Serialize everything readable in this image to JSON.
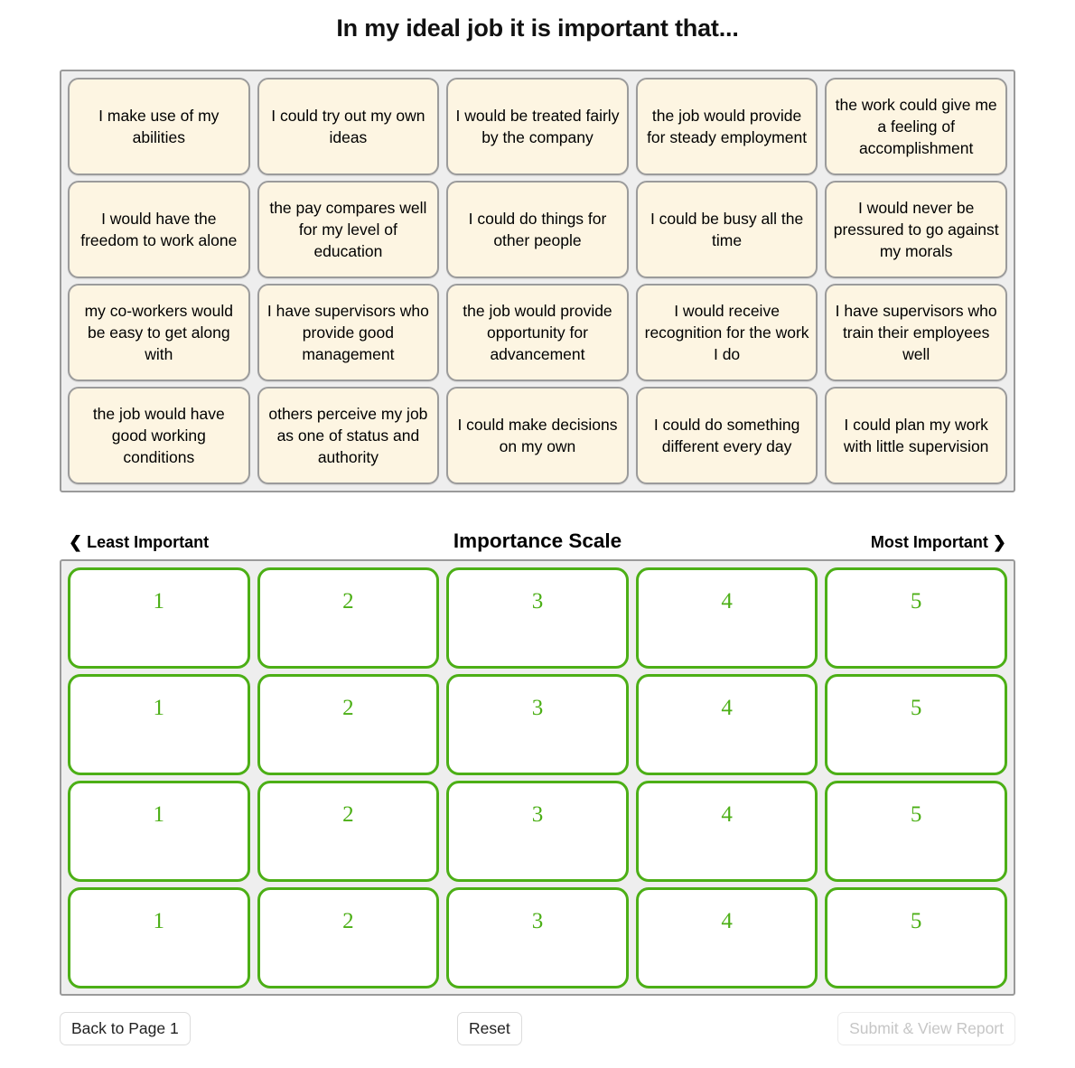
{
  "page": {
    "title": "In my ideal job it is important that..."
  },
  "card_pool": {
    "rows": [
      [
        {
          "text": "I make use of my abilities"
        },
        {
          "text": "I could try out my own ideas"
        },
        {
          "text": "I would be treated fairly by the company"
        },
        {
          "text": "the job would provide for steady employment"
        },
        {
          "text": "the work could give me a feeling of accomplishment"
        }
      ],
      [
        {
          "text": "I would have the freedom to work alone"
        },
        {
          "text": "the pay compares well for my level of education"
        },
        {
          "text": "I could do things for other people"
        },
        {
          "text": "I could be busy all the time"
        },
        {
          "text": "I would never be pressured to go against my morals"
        }
      ],
      [
        {
          "text": "my co-workers would be easy to get along with"
        },
        {
          "text": "I have supervisors who provide good management"
        },
        {
          "text": "the job would provide opportunity for advancement"
        },
        {
          "text": "I would receive recognition for the work I do"
        },
        {
          "text": "I have supervisors who train their employees well"
        }
      ],
      [
        {
          "text": "the job would have good working conditions"
        },
        {
          "text": "others perceive my job as one of status and authority"
        },
        {
          "text": "I could make decisions on my own"
        },
        {
          "text": "I could do something different every day"
        },
        {
          "text": "I could plan my work with little supervision"
        }
      ]
    ]
  },
  "scale": {
    "least_label": "❮ Least Important",
    "title": "Importance Scale",
    "most_label": "Most Important ❯",
    "accent_color": "#4caf16",
    "rows": [
      [
        "1",
        "2",
        "3",
        "4",
        "5"
      ],
      [
        "1",
        "2",
        "3",
        "4",
        "5"
      ],
      [
        "1",
        "2",
        "3",
        "4",
        "5"
      ],
      [
        "1",
        "2",
        "3",
        "4",
        "5"
      ]
    ]
  },
  "footer": {
    "back_label": "Back to Page 1",
    "reset_label": "Reset",
    "submit_label": "Submit & View Report"
  }
}
